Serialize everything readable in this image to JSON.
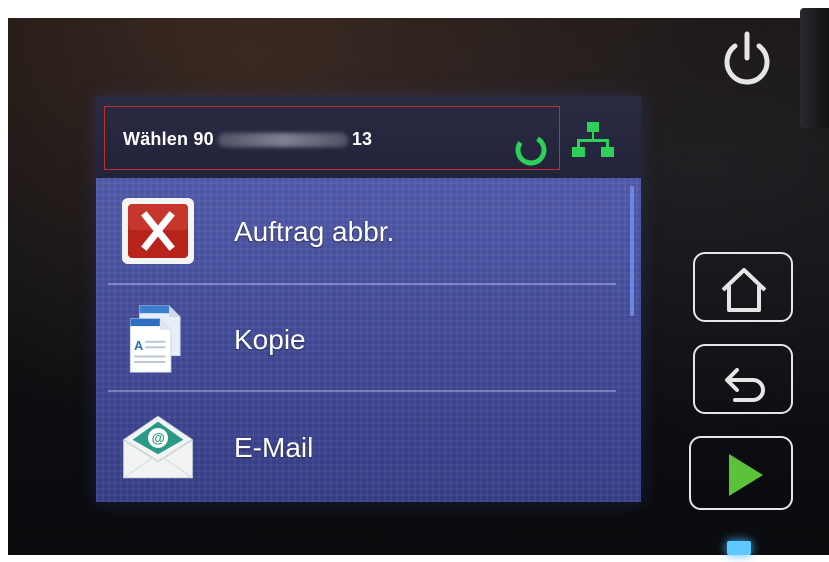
{
  "status_bar": {
    "dial_prefix": "Wählen 90",
    "dial_suffix": "13",
    "busy_icon": "busy-spinner-icon",
    "network_icon": "network-icon"
  },
  "menu": {
    "items": [
      {
        "label": "Auftrag abbr.",
        "icon": "cancel-job-icon"
      },
      {
        "label": "Kopie",
        "icon": "copy-icon"
      },
      {
        "label": "E-Mail",
        "icon": "email-icon"
      }
    ]
  },
  "hardware_buttons": {
    "power": "power-icon",
    "home": "home-icon",
    "back": "back-icon",
    "start": "start-icon"
  },
  "colors": {
    "accent_green": "#2fd05a",
    "start_green": "#5cc23a",
    "error_red": "#c0302a",
    "led_blue": "#5cc8ff"
  }
}
